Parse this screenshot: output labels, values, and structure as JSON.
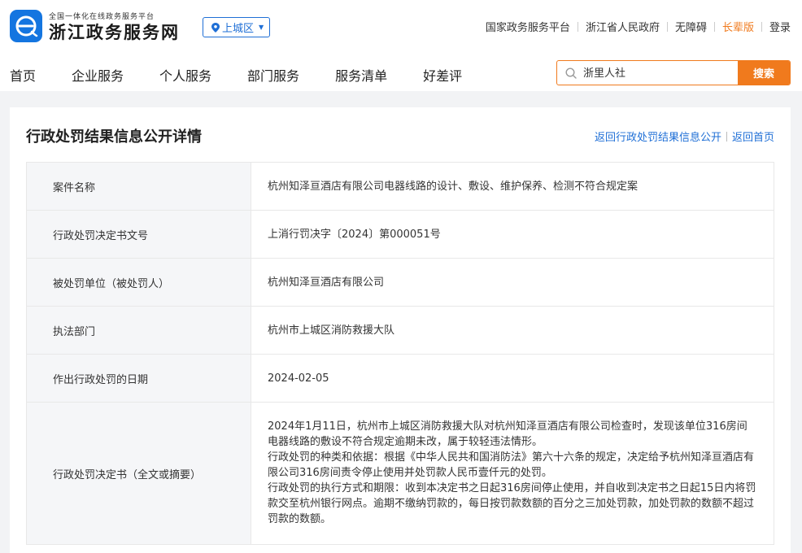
{
  "header": {
    "logo_small": "全国一体化在线政务服务平台",
    "logo_big": "浙江政务服务网",
    "region": "上城区",
    "top_links": [
      "国家政务服务平台",
      "浙江省人民政府",
      "无障碍",
      "长辈版",
      "登录"
    ],
    "nav": [
      "首页",
      "企业服务",
      "个人服务",
      "部门服务",
      "服务清单",
      "好差评"
    ],
    "search": {
      "placeholder": "浙里人社",
      "button": "搜索"
    }
  },
  "colors": {
    "brand_blue": "#1f6fd6",
    "accent_orange": "#f07a1d"
  },
  "page": {
    "title": "行政处罚结果信息公开详情",
    "link_back_list": "返回行政处罚结果信息公开",
    "link_home": "返回首页"
  },
  "details": [
    {
      "label": "案件名称",
      "value": "杭州知泽亘酒店有限公司电器线路的设计、敷设、维护保养、检测不符合规定案"
    },
    {
      "label": "行政处罚决定书文号",
      "value": "上消行罚决字〔2024〕第000051号"
    },
    {
      "label": "被处罚单位（被处罚人）",
      "value": "杭州知泽亘酒店有限公司"
    },
    {
      "label": "执法部门",
      "value": "杭州市上城区消防救援大队"
    },
    {
      "label": "作出行政处罚的日期",
      "value": "2024-02-05"
    }
  ],
  "decision": {
    "label": "行政处罚决定书（全文或摘要）",
    "paragraphs": [
      "2024年1月11日，杭州市上城区消防救援大队对杭州知泽亘酒店有限公司检查时，发现该单位316房间电器线路的敷设不符合规定逾期未改，属于较轻违法情形。",
      "行政处罚的种类和依据：根据《中华人民共和国消防法》第六十六条的规定，决定给予杭州知泽亘酒店有限公司316房间责令停止使用并处罚款人民币壹仟元的处罚。",
      "行政处罚的执行方式和期限：收到本决定书之日起316房间停止使用，并自收到决定书之日起15日内将罚款交至杭州银行网点。逾期不缴纳罚款的，每日按罚款数额的百分之三加处罚款，加处罚款的数额不超过罚款的数额。"
    ]
  }
}
